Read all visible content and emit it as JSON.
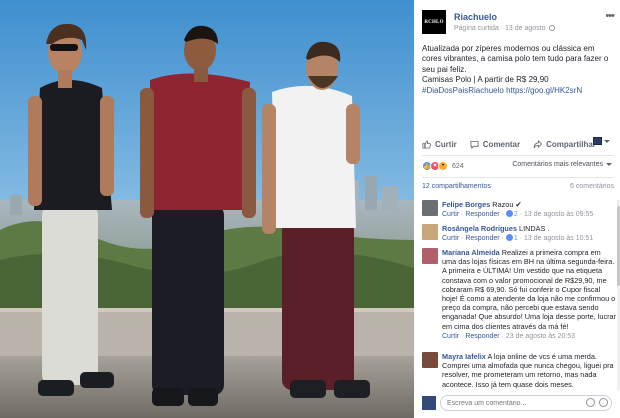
{
  "post": {
    "page_logo_text": "RCHLO",
    "page_name": "Riachuelo",
    "meta_curtida": "Página curtida",
    "meta_date": "13 de agosto",
    "text_lines": [
      "Atualizada por zíperes modernos ou clássica em",
      "cores vibrantes, a camisa polo tem tudo para fazer o",
      "seu pai feliz.",
      "Camisas Polo | A partir de R$ 29,90"
    ],
    "hashtag": "#DiaDosPaisRiachuelo",
    "link": "https://goo.gl/HK2srN"
  },
  "actions": {
    "like": "Curtir",
    "comment": "Comentar",
    "share": "Compartilhar"
  },
  "reactions": {
    "count": "624",
    "sort_label": "Comentários mais relevantes"
  },
  "stats": {
    "shares": "12 compartilhamentos",
    "comments": "6 comentários"
  },
  "comments": [
    {
      "author": "Felipe Borges",
      "text": "Razou ✔",
      "like": "Curtir",
      "reply": "Responder",
      "reaction_count": "2",
      "date": "13 de agosto às 09:55"
    },
    {
      "author": "Rosângela Rodrigues",
      "text": "LINDAS .",
      "like": "Curtir",
      "reply": "Responder",
      "reaction_count": "1",
      "date": "13 de agosto às 10:51"
    },
    {
      "author": "Mariana Almeida",
      "text": "Realizei a primeira compra em uma das lojas físicas em BH na última segunda-feira. A primeira e ÚLTIMA! Um vestido que na etiqueta constava com o valor promocional de R$29,90, me cobraram R$ 69,90. Só fui conferir o Cupor fiscal hoje! É como a atendente da loja não me confirmou o preço da compra, não percebi que estava sendo enganada! Que absurdo! Uma loja desse porte, lucrar em cima dos clientes através da má fé!",
      "like": "Curtir",
      "reply": "Responder",
      "date": "23 de agosto às 20:53"
    },
    {
      "author": "Mayra Iafelix",
      "text": "A loja online de vcs é uma merda. Comprei uma almofada que nunca chegou, liguei pra resolver, me prometeram um retorno, mas nada acontece. Isso já tem quase dois meses."
    }
  ],
  "comment_box": {
    "placeholder": "Escreva um comentário..."
  },
  "colors": {
    "link": "#365899",
    "meta": "#90949c",
    "shirt_black": "#1b1c22",
    "shirt_red": "#8e2530",
    "shirt_white": "#f2f2f2"
  }
}
